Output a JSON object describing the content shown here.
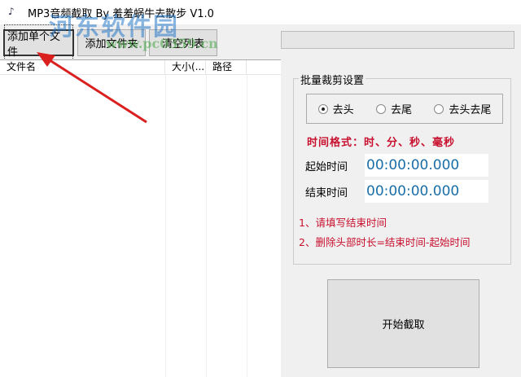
{
  "window": {
    "title": "MP3音频截取 By 羞羞蜗牛去散步 V1.0"
  },
  "toolbar": {
    "add_file": "添加单个文件",
    "add_folder": "添加文件夹",
    "clear_list": "清空列表"
  },
  "list": {
    "columns": [
      "文件名",
      "大小(...",
      "路径"
    ]
  },
  "settings": {
    "group_title": "批量裁剪设置",
    "radios": [
      {
        "label": "去头",
        "checked": true
      },
      {
        "label": "去尾",
        "checked": false
      },
      {
        "label": "去头去尾",
        "checked": false
      }
    ],
    "format_hint": "时间格式：时、分、秒、毫秒",
    "start_label": "起始时间",
    "start_value": "00:00:00.000",
    "end_label": "结束时间",
    "end_value": "00:00:00.000",
    "note1": "1、请填写结束时间",
    "note2": "2、删除头部时长=结束时间-起始时间"
  },
  "start_button": "开始截取",
  "watermark": {
    "name": "河东软件园",
    "url": "www.pc0359.cn"
  }
}
